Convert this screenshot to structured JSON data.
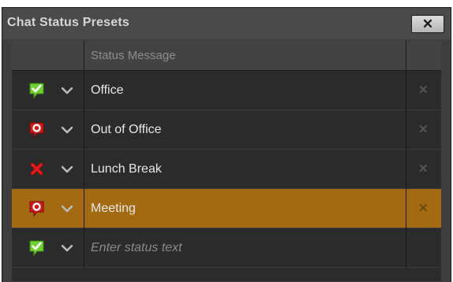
{
  "dialog": {
    "title": "Chat Status Presets",
    "close_label": "✕"
  },
  "grid": {
    "columns": [
      {
        "label": ""
      },
      {
        "label": "Status Message"
      },
      {
        "label": ""
      }
    ],
    "rows": [
      {
        "status": "available",
        "status_icon": "green-check-icon",
        "message": "Office",
        "selected": false,
        "delete_label": "✕"
      },
      {
        "status": "away",
        "status_icon": "red-ring-icon",
        "message": "Out of Office",
        "selected": false,
        "delete_label": "✕"
      },
      {
        "status": "busy",
        "status_icon": "red-x-icon",
        "message": "Lunch Break",
        "selected": false,
        "delete_label": "✕"
      },
      {
        "status": "away",
        "status_icon": "red-ring-icon",
        "message": "Meeting",
        "selected": true,
        "delete_label": "✕"
      }
    ],
    "new_row": {
      "status": "available",
      "status_icon": "green-check-icon",
      "placeholder": "Enter status text"
    }
  },
  "colors": {
    "selected_row": "#a46a12",
    "available": "#67c92e",
    "away": "#d01515"
  }
}
